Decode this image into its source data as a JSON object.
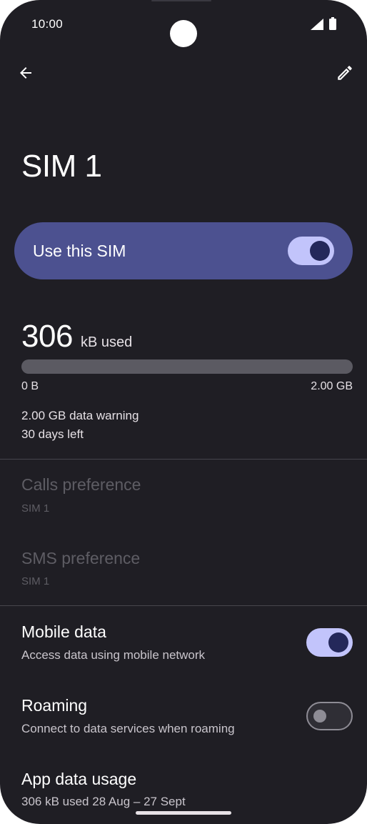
{
  "status_bar": {
    "time": "10:00"
  },
  "app_bar": {
    "back_icon": "arrow-back-icon",
    "edit_icon": "pencil-icon"
  },
  "page": {
    "title": "SIM 1"
  },
  "use_sim": {
    "label": "Use this SIM",
    "enabled": true
  },
  "usage": {
    "amount": "306",
    "unit": "kB used",
    "progress_fraction": 0.0,
    "range_min": "0 B",
    "range_max": "2.00 GB",
    "warning": "2.00 GB data warning",
    "days_left": "30 days left"
  },
  "calls_preference": {
    "title": "Calls preference",
    "value": "SIM 1"
  },
  "sms_preference": {
    "title": "SMS preference",
    "value": "SIM 1"
  },
  "mobile_data": {
    "title": "Mobile data",
    "subtitle": "Access data using mobile network",
    "enabled": true
  },
  "roaming": {
    "title": "Roaming",
    "subtitle": "Connect to data services when roaming",
    "enabled": false
  },
  "app_data_usage": {
    "title": "App data usage",
    "subtitle": "306 kB used 28 Aug – 27 Sept"
  },
  "colors": {
    "background": "#1f1e24",
    "accent_card": "#4c5190",
    "switch_on_track": "#c2c4fb",
    "switch_on_thumb": "#24285a",
    "usage_bar_track": "#5b5a62"
  }
}
